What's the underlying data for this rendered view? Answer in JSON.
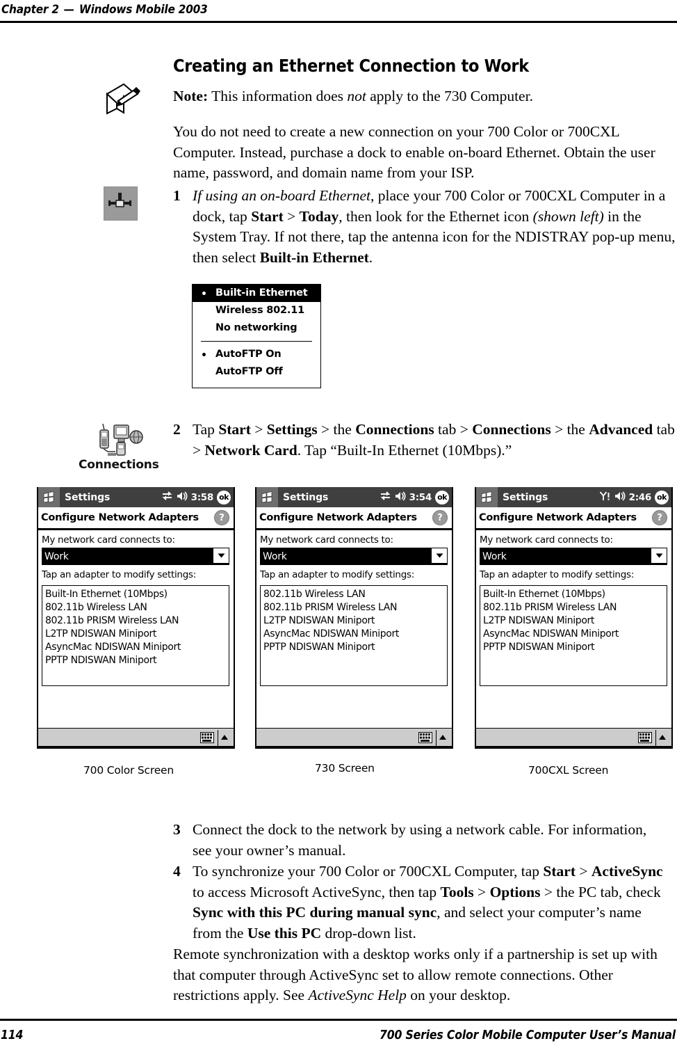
{
  "running_head": {
    "chapter": "Chapter 2",
    "dash": "—",
    "title": "Windows Mobile 2003"
  },
  "heading": "Creating an Ethernet Connection to Work",
  "note": {
    "label": "Note:",
    "text_before_italic": " This information does ",
    "italic": "not",
    "text_after_italic": " apply to the 730 Computer."
  },
  "intro_paragraph": "You do not need to create a new connection on your 700 Color or 700CXL Computer. Instead, purchase a dock to enable on-board Ethernet. Obtain the user name, password, and domain name from your ISP.",
  "steps": {
    "step1": {
      "number": "1",
      "p1_italic": "If using an on-board Ethernet",
      "p2": ", place your 700 Color or 700CXL Computer in a dock, tap ",
      "b1": "Start",
      "gt1": " > ",
      "b2": "Today",
      "p3": ", then look for the Ethernet icon ",
      "i2": "(shown left)",
      "p4": " in the System Tray. If not there, tap the antenna icon for the NDISTRAY pop-up menu, then select ",
      "b3": "Built-in Ethernet",
      "p5": "."
    },
    "step2": {
      "number": "2",
      "p1": "Tap ",
      "b1": "Start",
      "gt1": " > ",
      "b2": "Settings",
      "gt2": " > the ",
      "b3": "Connections",
      "p2": " tab > ",
      "b4": "Connections",
      "gt3": " > the ",
      "b5": "Advanced",
      "p3": " tab > ",
      "b6": "Network Card",
      "p4": ". Tap “Built-In Ethernet (10Mbps).”"
    },
    "step3": {
      "number": "3",
      "text": "Connect the dock to the network by using a network cable. For information, see your owner’s manual."
    },
    "step4": {
      "number": "4",
      "p1": "To synchronize your 700 Color or 700CXL Computer, tap ",
      "b1": "Start",
      "gt1": " > ",
      "b2": "ActiveSync",
      "p2": " to access Microsoft ActiveSync, then tap ",
      "b3": "Tools",
      "gt2": " > ",
      "b4": "Options",
      "p3": " > the PC tab, check ",
      "b5": "Sync with this PC during manual sync",
      "p4": ", and select your computer’s name from the ",
      "b6": "Use this PC",
      "p5": " drop-down list."
    }
  },
  "remote_paragraph": {
    "p1": "Remote synchronization with a desktop works only if a partnership is set up with that computer through ActiveSync set to allow remote connections. Other restrictions apply. See ",
    "italic": "ActiveSync Help",
    "p2": " on your desktop."
  },
  "ndistray_menu": {
    "items": [
      {
        "label": "Built-in Ethernet",
        "bullet": true,
        "selected": true
      },
      {
        "label": "Wireless 802.11",
        "bullet": false,
        "selected": false
      },
      {
        "label": "No networking",
        "bullet": false,
        "selected": false
      },
      {
        "label": "AutoFTP On",
        "bullet": true,
        "selected": false
      },
      {
        "label": "AutoFTP Off",
        "bullet": false,
        "selected": false
      }
    ]
  },
  "connections_icon_label": "Connections",
  "screenshots": [
    {
      "app_title": "Settings",
      "status_icon": "sync-arrows-icon",
      "volume_icon": "speaker-icon",
      "clock": "3:58",
      "ok_label": "ok",
      "page_title": "Configure Network Adapters",
      "help_label": "?",
      "combo_label": "My network card connects to:",
      "combo_value": "Work",
      "list_label": "Tap an adapter to modify settings:",
      "adapters": [
        "Built-In Ethernet (10Mbps)",
        "802.11b Wireless LAN",
        "802.11b PRISM Wireless LAN",
        "L2TP NDISWAN Miniport",
        "AsyncMac NDISWAN Miniport",
        "PPTP NDISWAN Miniport"
      ],
      "caption": "700 Color Screen"
    },
    {
      "app_title": "Settings",
      "status_icon": "sync-arrows-icon",
      "volume_icon": "speaker-icon",
      "clock": "3:54",
      "ok_label": "ok",
      "page_title": "Configure Network Adapters",
      "help_label": "?",
      "combo_label": "My network card connects to:",
      "combo_value": "Work",
      "list_label": "Tap an adapter to modify settings:",
      "adapters": [
        "802.11b Wireless LAN",
        "802.11b PRISM Wireless LAN",
        "L2TP NDISWAN Miniport",
        "AsyncMac NDISWAN Miniport",
        "PPTP NDISWAN Miniport"
      ],
      "caption": "730 Screen"
    },
    {
      "app_title": "Settings",
      "status_icon": "signal-alert-icon",
      "volume_icon": "speaker-icon",
      "clock": "2:46",
      "ok_label": "ok",
      "page_title": "Configure Network Adapters",
      "help_label": "?",
      "combo_label": "My network card connects to:",
      "combo_value": "Work",
      "list_label": "Tap an adapter to modify settings:",
      "adapters": [
        "Built-In Ethernet (10Mbps)",
        "802.11b PRISM Wireless LAN",
        "L2TP NDISWAN Miniport",
        "AsyncMac NDISWAN Miniport",
        "PPTP NDISWAN Miniport"
      ],
      "caption": "700CXL Screen"
    }
  ],
  "footer": {
    "page_number": "114",
    "manual_title": "700 Series Color Mobile Computer User’s Manual"
  },
  "colors": {
    "titlebar": "#3f3f3f",
    "start_box": "#6e6e6e",
    "sip_bar": "#cccccc",
    "selection": "#000000"
  }
}
